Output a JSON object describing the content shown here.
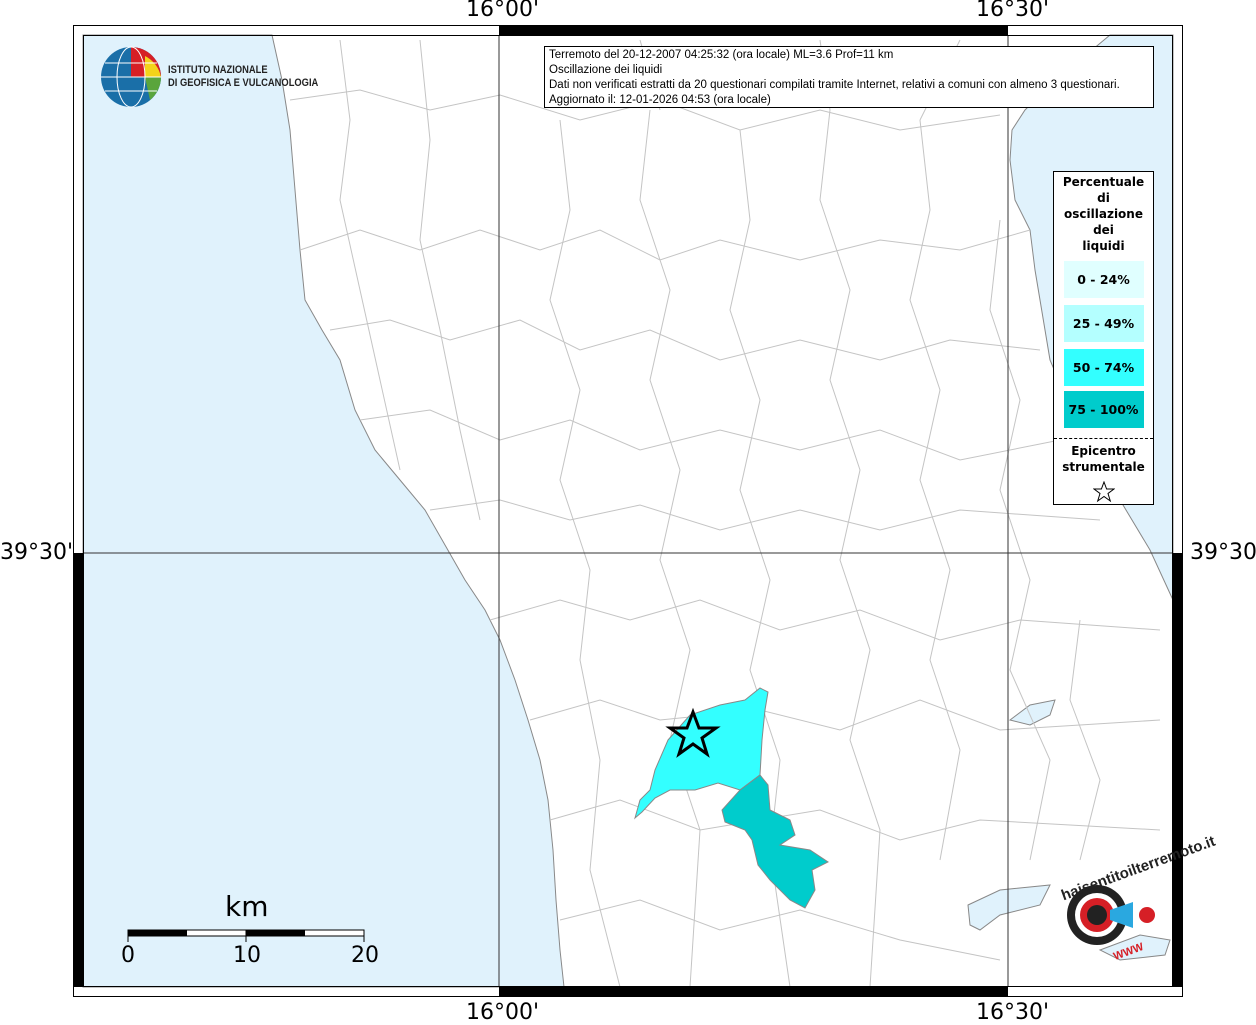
{
  "map": {
    "ticks": {
      "top": [
        "16°00'",
        "16°30'"
      ],
      "bottom": [
        "16°00'",
        "16°30'"
      ],
      "left": "39°30'",
      "right": "39°30'"
    },
    "colors": {
      "sea": "#e0f2fc",
      "land": "#ffffff",
      "boundary": "#bdbdbd"
    }
  },
  "logo": {
    "line1": "ISTITUTO NAZIONALE",
    "line2": "DI GEOFISICA E VULCANOLOGIA"
  },
  "info": {
    "line1": "Terremoto del 20-12-2007 04:25:32 (ora locale) ML=3.6 Prof=11 km",
    "line2": "Oscillazione dei liquidi",
    "line3": "Dati non verificati estratti da 20 questionari compilati tramite Internet, relativi a comuni con almeno 3 questionari.",
    "line4": "Aggiornato il: 12-01-2026 04:53 (ora locale)"
  },
  "legend": {
    "title_lines": [
      "Percentuale",
      "di",
      "oscillazione",
      "dei",
      "liquidi"
    ],
    "classes": [
      {
        "label": "0 - 24%",
        "color": "#e0ffff"
      },
      {
        "label": "25 - 49%",
        "color": "#b4ffff"
      },
      {
        "label": "50 - 74%",
        "color": "#33ffff"
      },
      {
        "label": "75 - 100%",
        "color": "#00cccc"
      }
    ],
    "epicenter_lines": [
      "Epicentro",
      "strumentale"
    ],
    "epicenter_icon": "star-outline-icon"
  },
  "scale_bar": {
    "unit": "km",
    "labels": [
      "0",
      "10",
      "20"
    ]
  },
  "watermark": {
    "text": "haisentitoilterremoto.it",
    "sub": "WWW"
  }
}
